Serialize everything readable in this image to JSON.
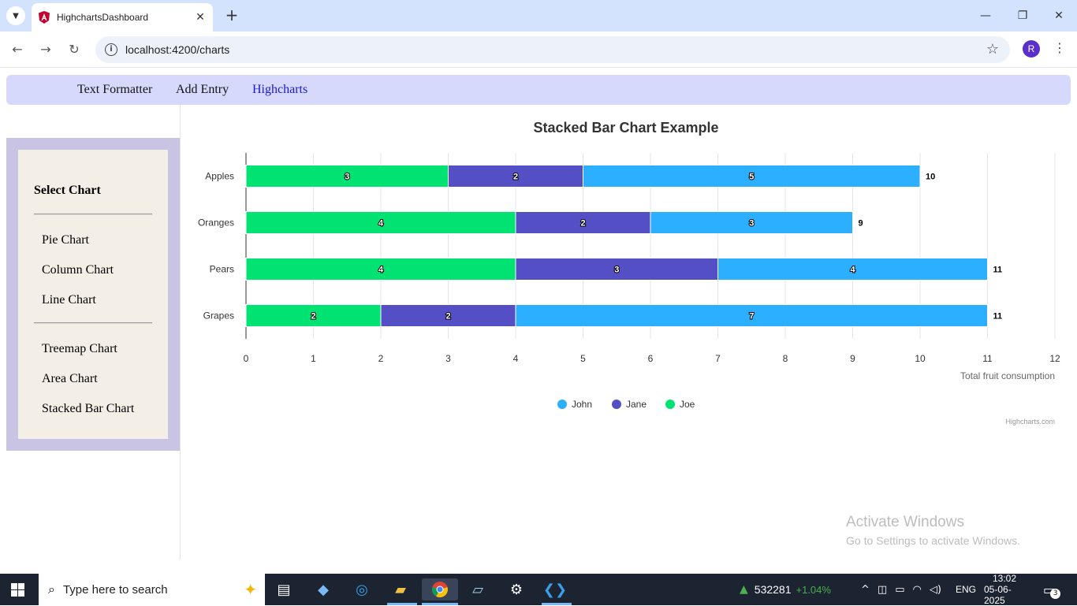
{
  "browser": {
    "tab_title": "HighchartsDashboard",
    "url": "localhost:4200/charts",
    "profile_initial": "R"
  },
  "nav": {
    "items": [
      "Text Formatter",
      "Add Entry",
      "Highcharts"
    ],
    "active": "Highcharts"
  },
  "sidebar": {
    "title": "Select Chart",
    "group1": [
      "Pie Chart",
      "Column Chart",
      "Line Chart"
    ],
    "group2": [
      "Treemap Chart",
      "Area Chart",
      "Stacked Bar Chart"
    ]
  },
  "chart_data": {
    "type": "bar",
    "stacked": true,
    "title": "Stacked Bar Chart Example",
    "categories": [
      "Apples",
      "Oranges",
      "Pears",
      "Grapes"
    ],
    "series": [
      {
        "name": "John",
        "color": "#2caffe",
        "values": [
          5,
          3,
          4,
          7
        ]
      },
      {
        "name": "Jane",
        "color": "#544fc5",
        "values": [
          2,
          2,
          3,
          2
        ]
      },
      {
        "name": "Joe",
        "color": "#00e272",
        "values": [
          3,
          4,
          4,
          2
        ]
      }
    ],
    "totals": [
      10,
      9,
      11,
      11
    ],
    "xlabel": "Total fruit consumption",
    "xlim": [
      0,
      12
    ],
    "ticks": [
      "0",
      "1",
      "2",
      "3",
      "4",
      "5",
      "6",
      "7",
      "8",
      "9",
      "10",
      "11",
      "12"
    ],
    "legend": [
      "John",
      "Jane",
      "Joe"
    ],
    "legend_position": "bottom-center",
    "grid": true,
    "credits": "Highcharts.com"
  },
  "watermark": {
    "line1": "Activate Windows",
    "line2": "Go to Settings to activate Windows."
  },
  "taskbar": {
    "search_placeholder": "Type here to search",
    "stock_value": "532281",
    "stock_change": "+1.04%",
    "lang": "ENG",
    "time": "13:02",
    "date": "05-06-2025",
    "notif_count": "3"
  }
}
